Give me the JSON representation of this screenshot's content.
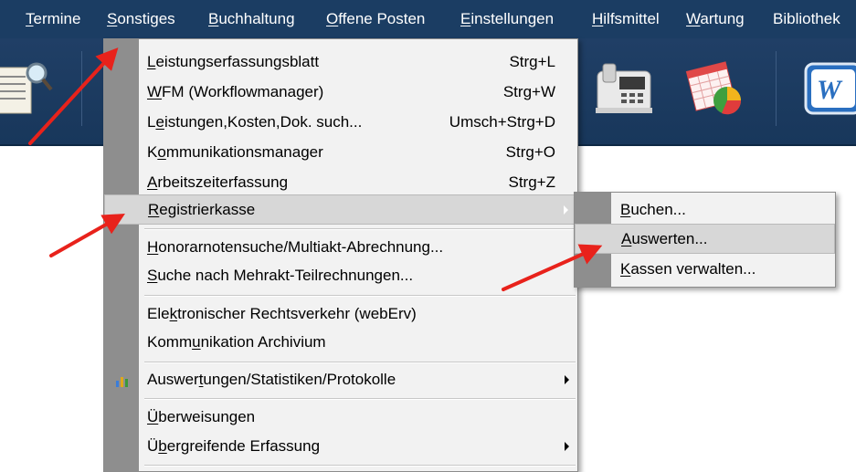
{
  "menubar": {
    "items": [
      {
        "label": "Termine",
        "accel": 0
      },
      {
        "label": "Sonstiges",
        "accel": 0
      },
      {
        "label": "Buchhaltung",
        "accel": 0
      },
      {
        "label": "Offene Posten",
        "accel": 0
      },
      {
        "label": "Einstellungen",
        "accel": 0
      },
      {
        "label": "Hilfsmittel",
        "accel": 0
      },
      {
        "label": "Wartung",
        "accel": 0
      },
      {
        "label": "Bibliothek",
        "accel": -1
      }
    ]
  },
  "menu": {
    "items": [
      {
        "label": "Leistungserfassungsblatt",
        "accel": 0,
        "shortcut": "Strg+L"
      },
      {
        "label": "WFM (Workflowmanager)",
        "accel": 0,
        "shortcut": "Strg+W"
      },
      {
        "label": "Leistungen,Kosten,Dok. such...",
        "accel": 1,
        "shortcut": "Umsch+Strg+D"
      },
      {
        "label": "Kommunikationsmanager",
        "accel": 1,
        "shortcut": "Strg+O"
      },
      {
        "label": "Arbeitszeiterfassung",
        "accel": 0,
        "shortcut": "Strg+Z"
      },
      {
        "label": "Registrierkasse",
        "accel": 0,
        "shortcut": ""
      },
      {
        "label": "Honorarnotensuche/Multiakt-Abrechnung...",
        "accel": 0,
        "shortcut": ""
      },
      {
        "label": "Suche nach Mehrakt-Teilrechnungen...",
        "accel": 0,
        "shortcut": ""
      },
      {
        "label": "Elektronischer Rechtsverkehr (webErv)",
        "accel": 3,
        "shortcut": ""
      },
      {
        "label": "Kommunikation Archivium",
        "accel": 4,
        "shortcut": ""
      },
      {
        "label": "Auswertungen/Statistiken/Protokolle",
        "accel": 6,
        "shortcut": ""
      },
      {
        "label": "Überweisungen",
        "accel": 0,
        "shortcut": ""
      },
      {
        "label": "Übergreifende Erfassung",
        "accel": 1,
        "shortcut": ""
      }
    ]
  },
  "submenu": {
    "items": [
      {
        "label": "Buchen...",
        "accel": 0
      },
      {
        "label": "Auswerten...",
        "accel": 0
      },
      {
        "label": "Kassen verwalten...",
        "accel": 0
      }
    ]
  },
  "colors": {
    "menubar_bg": "#1b3d63",
    "highlight_bg": "#d7d7d7",
    "gutter": "#8e8e8e",
    "annotation_arrow": "#e8221b"
  },
  "icons": [
    "document-search-icon",
    "fax-phone-icon",
    "calendar-chart-icon",
    "word-icon",
    "bar-chart-icon"
  ]
}
